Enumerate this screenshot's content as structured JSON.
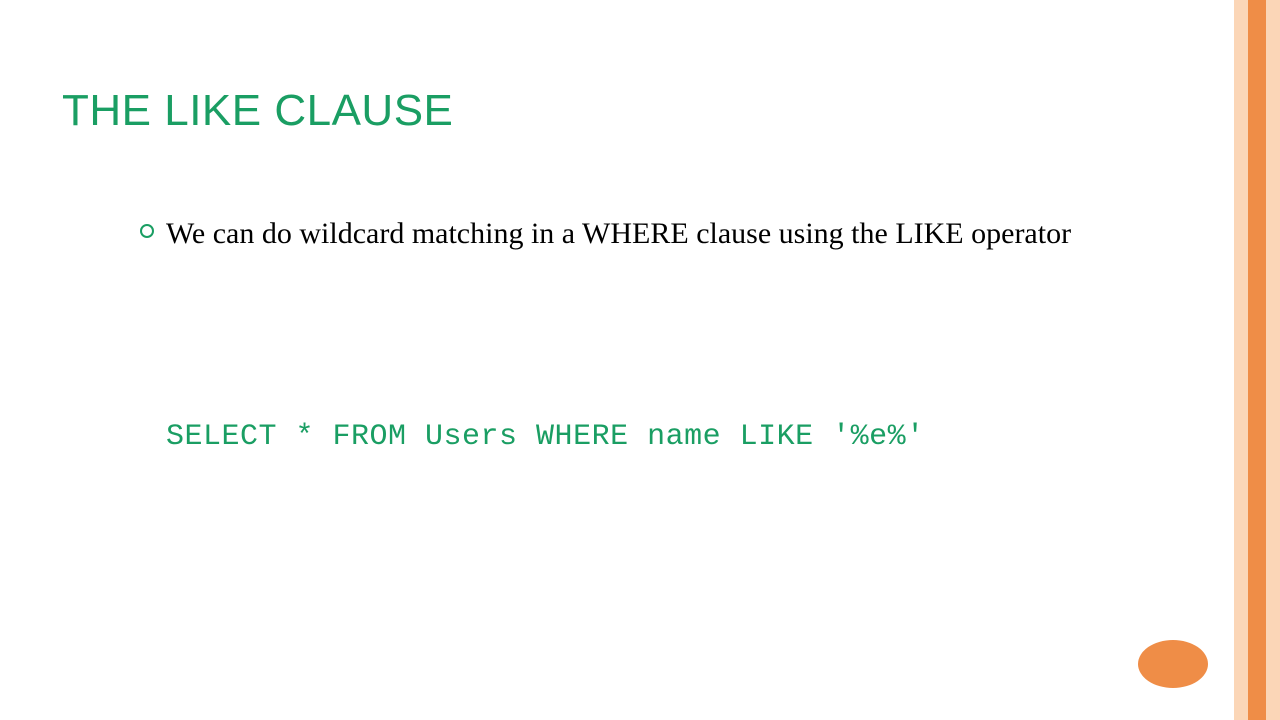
{
  "title": "THE LIKE CLAUSE",
  "bullet": {
    "text": "We can do wildcard matching in a WHERE clause using the LIKE operator"
  },
  "code": "SELECT * FROM Users WHERE name LIKE '%e%'",
  "theme": {
    "accent": "#1a9e63",
    "stripe_outer": "#fbd6b7",
    "stripe_inner": "#ef8d47"
  }
}
